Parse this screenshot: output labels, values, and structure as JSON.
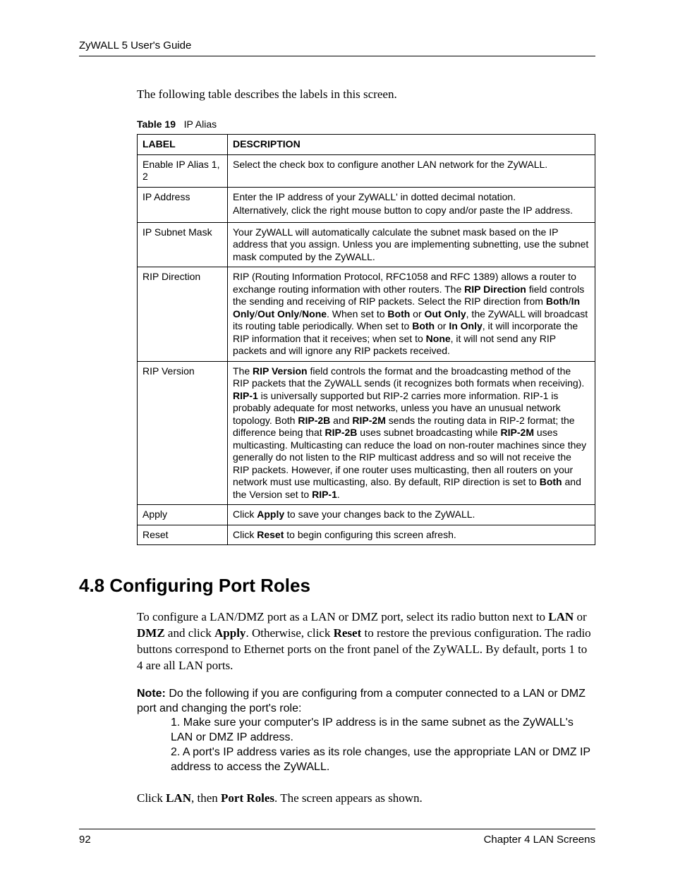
{
  "header": {
    "title": "ZyWALL 5 User's Guide"
  },
  "intro": "The following table describes the labels in this screen.",
  "table": {
    "caption_label": "Table 19",
    "caption_name": "IP Alias",
    "head_label": "LABEL",
    "head_desc": "DESCRIPTION",
    "rows": {
      "r0": {
        "label": "Enable IP Alias 1, 2",
        "desc": "Select the check box to configure another LAN network for the ZyWALL."
      },
      "r1": {
        "label": "IP Address",
        "desc1": "Enter the IP address of your ZyWALL' in dotted decimal notation.",
        "desc2": "Alternatively, click the right mouse button to copy and/or paste the IP address."
      },
      "r2": {
        "label": "IP Subnet Mask",
        "desc": "Your ZyWALL will automatically calculate the subnet mask based on the IP address that you assign. Unless you are implementing subnetting, use the subnet mask computed by the ZyWALL."
      },
      "r3": {
        "label": "RIP Direction",
        "p1a": "RIP (Routing Information Protocol, RFC1058 and RFC 1389) allows a router to exchange routing information with other routers. The ",
        "p1b": "RIP Direction",
        "p1c": " field controls the sending and receiving of RIP packets. Select the RIP direction from ",
        "p1d": "Both",
        "p1e": "/",
        "p1f": "In Only",
        "p1g": "/",
        "p1h": "Out Only",
        "p1i": "/",
        "p1j": "None",
        "p1k": ". When set to ",
        "p1l": "Both",
        "p1m": " or ",
        "p1n": "Out Only",
        "p1o": ", the ZyWALL will broadcast its routing table periodically. When set to ",
        "p1p": "Both",
        "p1q": " or ",
        "p1r": "In Only",
        "p1s": ", it will incorporate the RIP information that it receives; when set to ",
        "p1t": "None",
        "p1u": ", it will not send any RIP packets and will ignore any RIP packets received."
      },
      "r4": {
        "label": "RIP Version",
        "p1a": "The ",
        "p1b": "RIP Version",
        "p1c": " field controls the format and the broadcasting method of the RIP packets that the ZyWALL sends (it recognizes both formats when receiving). ",
        "p1d": "RIP-1",
        "p1e": " is universally supported but RIP-2 carries more information. RIP-1 is probably adequate for most networks, unless you have an unusual network topology. Both ",
        "p1f": "RIP-2B",
        "p1g": " and ",
        "p1h": "RIP-2M",
        "p1i": " sends the routing data in RIP-2 format; the difference being that ",
        "p1j": "RIP-2B",
        "p1k": " uses subnet broadcasting while ",
        "p1l": "RIP-2M",
        "p1m": " uses multicasting. Multicasting can reduce the load on non-router machines since they generally do not listen to the RIP multicast address and so will not receive the RIP packets. However, if one router uses multicasting, then all routers on your network must use multicasting, also. By default, RIP direction is set to ",
        "p1n": "Both",
        "p1o": " and the Version set to ",
        "p1p": "RIP-1",
        "p1q": "."
      },
      "r5": {
        "label": "Apply",
        "p1a": "Click ",
        "p1b": "Apply",
        "p1c": " to save your changes back to the ZyWALL."
      },
      "r6": {
        "label": "Reset",
        "p1a": "Click ",
        "p1b": "Reset",
        "p1c": " to begin configuring this screen afresh."
      }
    }
  },
  "section": {
    "heading": "4.8  Configuring Port Roles",
    "para1": {
      "a": "To configure a LAN/DMZ port as a LAN or DMZ port, select its radio button next to ",
      "b": "LAN",
      "c": " or ",
      "d": "DMZ",
      "e": " and click ",
      "f": "Apply",
      "g": ". Otherwise, click ",
      "h": "Reset",
      "i": " to restore the previous configuration. The radio buttons correspond to Ethernet ports on the front panel of the ZyWALL. By default, ports 1 to 4 are all LAN ports."
    },
    "note": {
      "label": "Note:",
      "lead": " Do the following if you are configuring from a computer connected to a LAN or DMZ port and changing the port's role:",
      "l1": "1. Make sure your computer's IP address is in the same subnet as the ZyWALL's LAN or DMZ IP address.",
      "l2": "2. A port's IP address varies as its role changes, use the appropriate LAN or DMZ IP address to access the ZyWALL."
    },
    "para2": {
      "a": "Click ",
      "b": "LAN",
      "c": ", then ",
      "d": "Port Roles",
      "e": ". The screen appears as shown."
    }
  },
  "footer": {
    "page": "92",
    "chapter": "Chapter 4 LAN Screens"
  }
}
